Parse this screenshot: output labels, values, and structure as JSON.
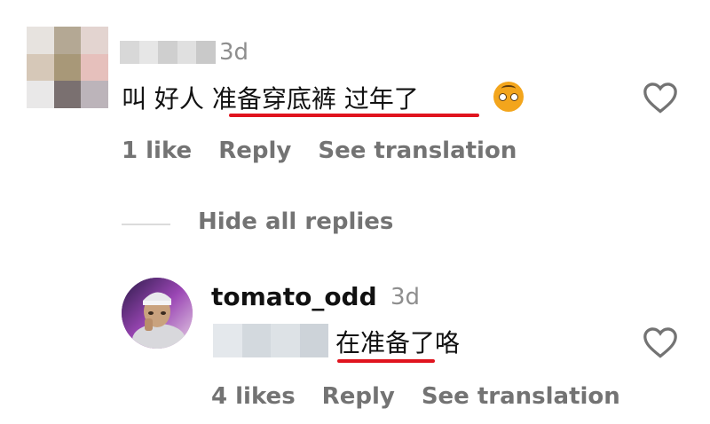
{
  "comment": {
    "time": "3d",
    "text_prefix": "叫 好人 ",
    "text_highlight": "准备穿底裤 过年了",
    "emoji": "flushed-face",
    "likes": "1 like",
    "reply": "Reply",
    "translate": "See translation"
  },
  "replies_toggle": "Hide all replies",
  "reply": {
    "username": "tomato_odd",
    "time": "3d",
    "text": "在准备了咯",
    "likes": "4 likes",
    "reply": "Reply",
    "translate": "See translation"
  },
  "colors": {
    "highlight_underline": "#e0141e",
    "meta_text": "#737373",
    "heart_stroke": "#737373"
  }
}
